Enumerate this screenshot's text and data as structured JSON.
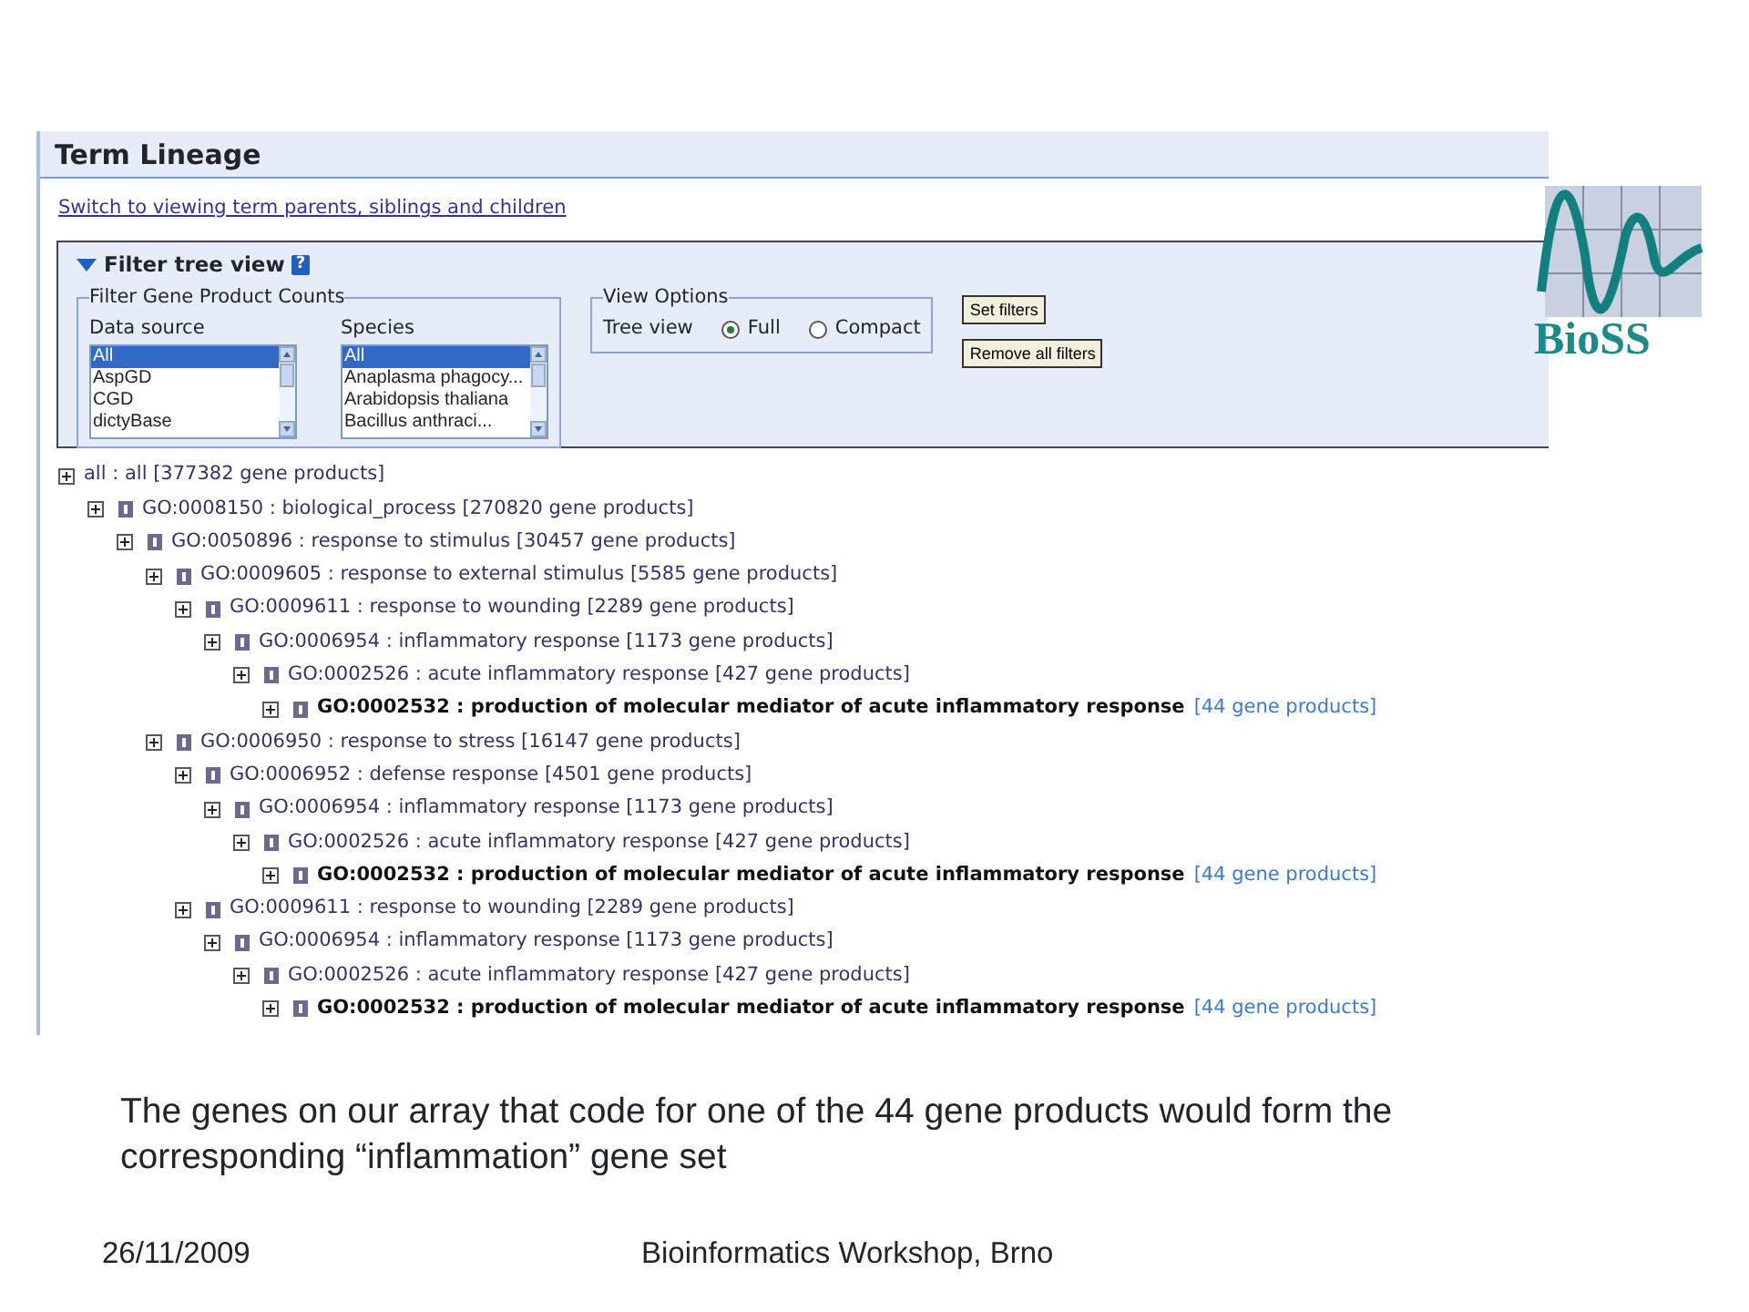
{
  "logo": {
    "text": "BioSS"
  },
  "panel": {
    "title": "Term Lineage",
    "switch_link": "Switch to viewing term parents, siblings and children",
    "filter": {
      "title": "Filter tree view",
      "expanded": true,
      "help": "?",
      "counts_legend": "Filter Gene Product Counts",
      "lists": [
        {
          "label": "Data source",
          "options": [
            {
              "text": "All",
              "selected": true
            },
            {
              "text": "AspGD",
              "selected": false
            },
            {
              "text": "CGD",
              "selected": false
            },
            {
              "text": "dictyBase",
              "selected": false
            }
          ]
        },
        {
          "label": "Species",
          "options": [
            {
              "text": "All",
              "selected": true
            },
            {
              "text": "Anaplasma phagocy...",
              "selected": false
            },
            {
              "text": "Arabidopsis thaliana",
              "selected": false
            },
            {
              "text": "Bacillus anthraci...",
              "selected": false
            }
          ]
        }
      ],
      "view_legend": "View Options",
      "view_label": "Tree view",
      "radios": [
        {
          "label": "Full",
          "selected": true
        },
        {
          "label": "Compact",
          "selected": false
        }
      ],
      "buttons": [
        "Set filters",
        "Remove all filters"
      ]
    },
    "tree": [
      {
        "kind": "root",
        "term": "all : all",
        "count": "[377382 gene products]",
        "children": [
          {
            "kind": "term",
            "term": "GO:0008150 : biological_process",
            "count": "[270820 gene products]",
            "children": [
              {
                "kind": "term",
                "term": "GO:0050896 : response to stimulus",
                "count": "[30457 gene products]",
                "children": [
                  {
                    "kind": "term",
                    "term": "GO:0009605 : response to external stimulus",
                    "count": "[5585 gene products]",
                    "children": [
                      {
                        "kind": "term",
                        "term": "GO:0009611 : response to wounding",
                        "count": "[2289 gene products]",
                        "children": [
                          {
                            "kind": "term",
                            "term": "GO:0006954 : inflammatory response",
                            "count": "[1173 gene products]",
                            "children": [
                              {
                                "kind": "term",
                                "term": "GO:0002526 : acute inflammatory response",
                                "count": "[427 gene products]",
                                "children": [
                                  {
                                    "kind": "target",
                                    "term": "GO:0002532 : production of molecular mediator of acute inflammatory response",
                                    "count": "[44 gene products]"
                                  }
                                ]
                              }
                            ]
                          }
                        ]
                      }
                    ]
                  },
                  {
                    "kind": "term",
                    "term": "GO:0006950 : response to stress",
                    "count": "[16147 gene products]",
                    "children": [
                      {
                        "kind": "term",
                        "term": "GO:0006952 : defense response",
                        "count": "[4501 gene products]",
                        "children": [
                          {
                            "kind": "term",
                            "term": "GO:0006954 : inflammatory response",
                            "count": "[1173 gene products]",
                            "children": [
                              {
                                "kind": "term",
                                "term": "GO:0002526 : acute inflammatory response",
                                "count": "[427 gene products]",
                                "children": [
                                  {
                                    "kind": "target",
                                    "term": "GO:0002532 : production of molecular mediator of acute inflammatory response",
                                    "count": "[44 gene products]"
                                  }
                                ]
                              }
                            ]
                          }
                        ]
                      },
                      {
                        "kind": "term",
                        "term": "GO:0009611 : response to wounding",
                        "count": "[2289 gene products]",
                        "children": [
                          {
                            "kind": "term",
                            "term": "GO:0006954 : inflammatory response",
                            "count": "[1173 gene products]",
                            "children": [
                              {
                                "kind": "term",
                                "term": "GO:0002526 : acute inflammatory response",
                                "count": "[427 gene products]",
                                "children": [
                                  {
                                    "kind": "target",
                                    "term": "GO:0002532 : production of molecular mediator of acute inflammatory response",
                                    "count": "[44 gene products]"
                                  }
                                ]
                              }
                            ]
                          }
                        ]
                      }
                    ]
                  }
                ]
              }
            ]
          }
        ]
      }
    ]
  },
  "caption": "The genes on our array that code for one of the 44 gene products would form the corresponding “inflammation” gene set",
  "footer": {
    "date": "26/11/2009",
    "title": "Bioinformatics Workshop, Brno"
  }
}
